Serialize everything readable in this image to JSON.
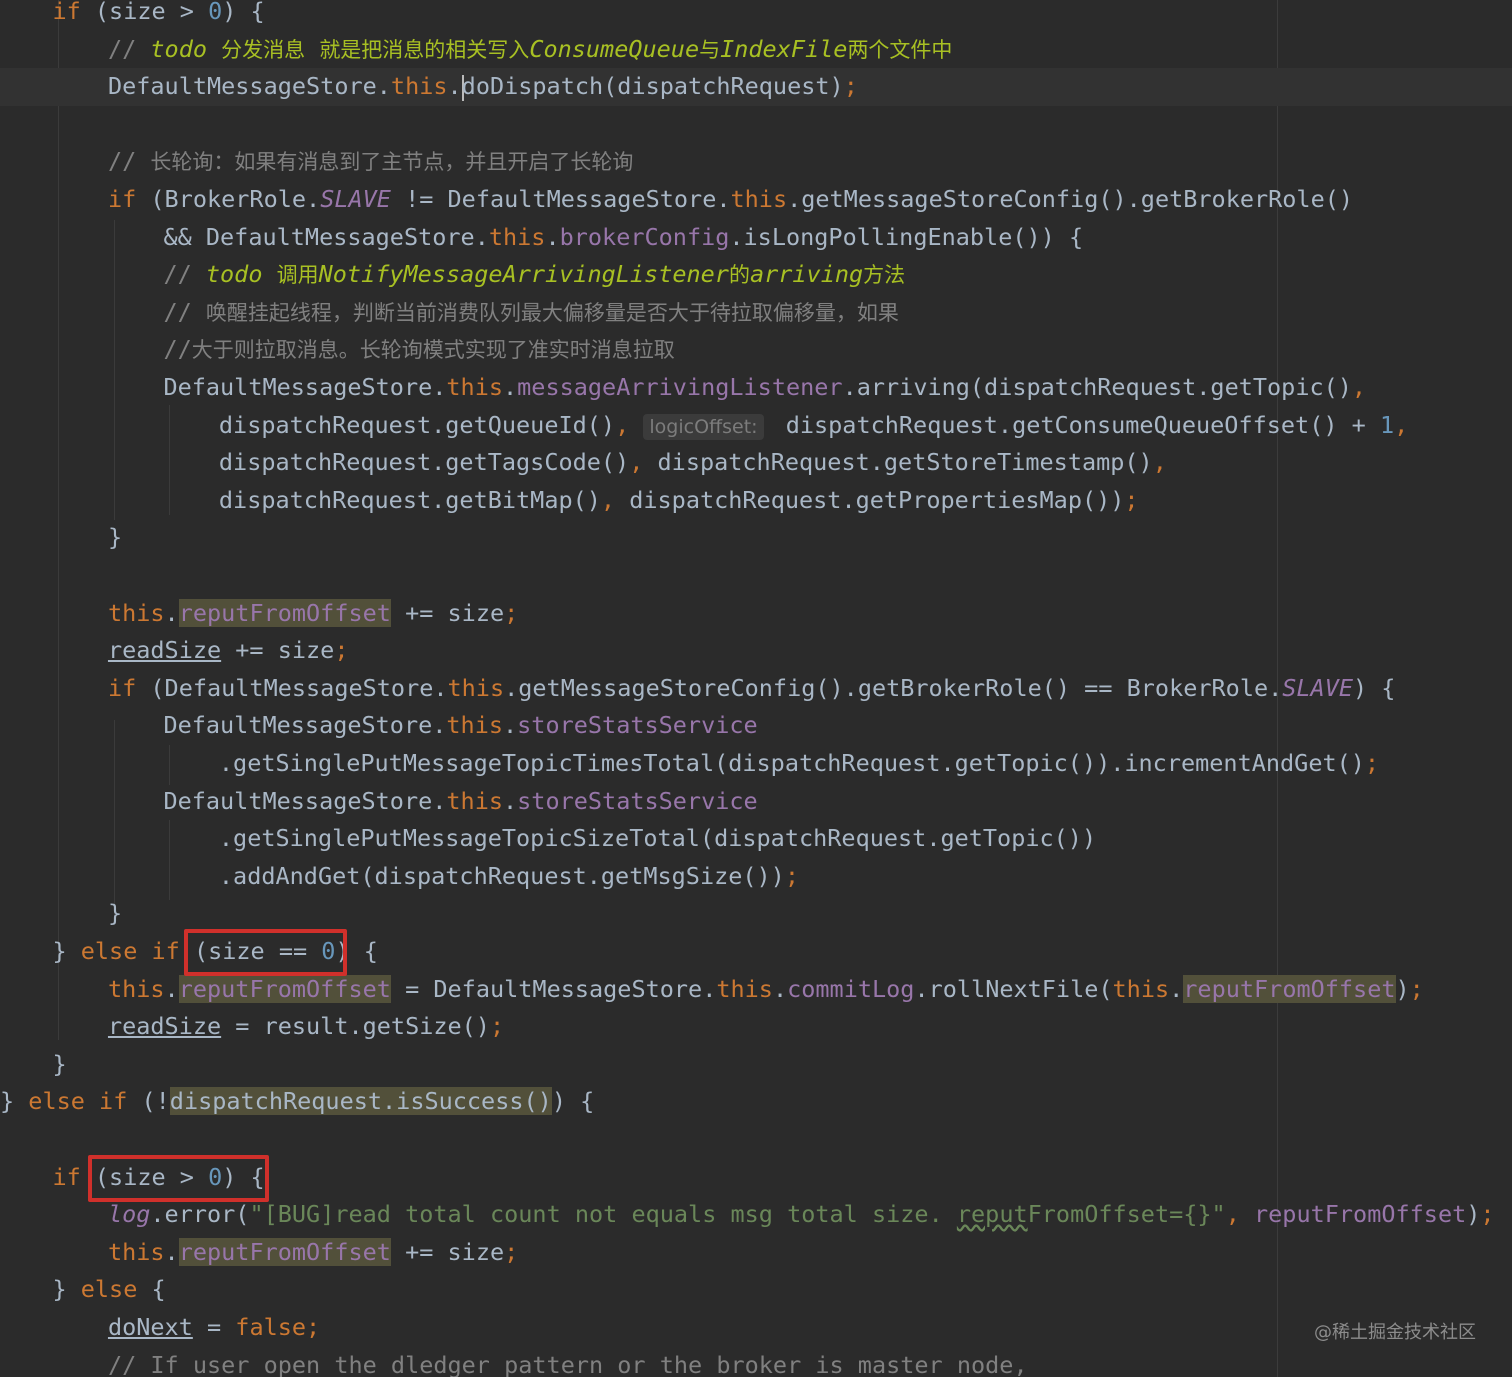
{
  "code": {
    "lines": [
      "if (size > 0) {",
      "// todo 分发消息 就是把消息的相关写入ConsumeQueue与IndexFile两个文件中",
      "DefaultMessageStore.this.doDispatch(dispatchRequest);",
      "",
      "// 长轮询：如果有消息到了主节点，并且开启了长轮询",
      "if (BrokerRole.SLAVE != DefaultMessageStore.this.getMessageStoreConfig().getBrokerRole()",
      "&& DefaultMessageStore.this.brokerConfig.isLongPollingEnable()) {",
      "// todo 调用NotifyMessageArrivingListener的arriving方法",
      "// 唤醒挂起线程，判断当前消费队列最大偏移量是否大于待拉取偏移量，如果",
      "//大于则拉取消息。长轮询模式实现了准实时消息拉取",
      "DefaultMessageStore.this.messageArrivingListener.arriving(dispatchRequest.getTopic(),",
      "dispatchRequest.getQueueId(), logicOffset: dispatchRequest.getConsumeQueueOffset() + 1,",
      "dispatchRequest.getTagsCode(), dispatchRequest.getStoreTimestamp(),",
      "dispatchRequest.getBitMap(), dispatchRequest.getPropertiesMap());",
      "}",
      "",
      "this.reputFromOffset += size;",
      "readSize += size;",
      "if (DefaultMessageStore.this.getMessageStoreConfig().getBrokerRole() == BrokerRole.SLAVE) {",
      "DefaultMessageStore.this.storeStatsService",
      ".getSinglePutMessageTopicTimesTotal(dispatchRequest.getTopic()).incrementAndGet();",
      "DefaultMessageStore.this.storeStatsService",
      ".getSinglePutMessageTopicSizeTotal(dispatchRequest.getTopic())",
      ".addAndGet(dispatchRequest.getMsgSize());",
      "}",
      "} else if (size == 0) {",
      "this.reputFromOffset = DefaultMessageStore.this.commitLog.rollNextFile(this.reputFromOffset);",
      "readSize = result.getSize();",
      "}",
      "} else if (!dispatchRequest.isSuccess()) {",
      "",
      "if (size > 0) {",
      "log.error(\"[BUG]read total count not equals msg total size. reputFromOffset={}\", reputFromOffset);",
      "this.reputFromOffset += size;",
      "} else {",
      "doNext = false;",
      "// If user open the dledger pattern or the broker is master node,"
    ],
    "inlay_hint": "logicOffset:"
  },
  "watermark": "@稀土掘金技术社区",
  "colors": {
    "background": "#2b2b2b",
    "keyword": "#cc7832",
    "number": "#6897bb",
    "comment": "#808080",
    "todo": "#a8c023",
    "field": "#9876aa",
    "string": "#6a8759",
    "text": "#a9b7c6",
    "annotation_box": "#d0302b"
  }
}
